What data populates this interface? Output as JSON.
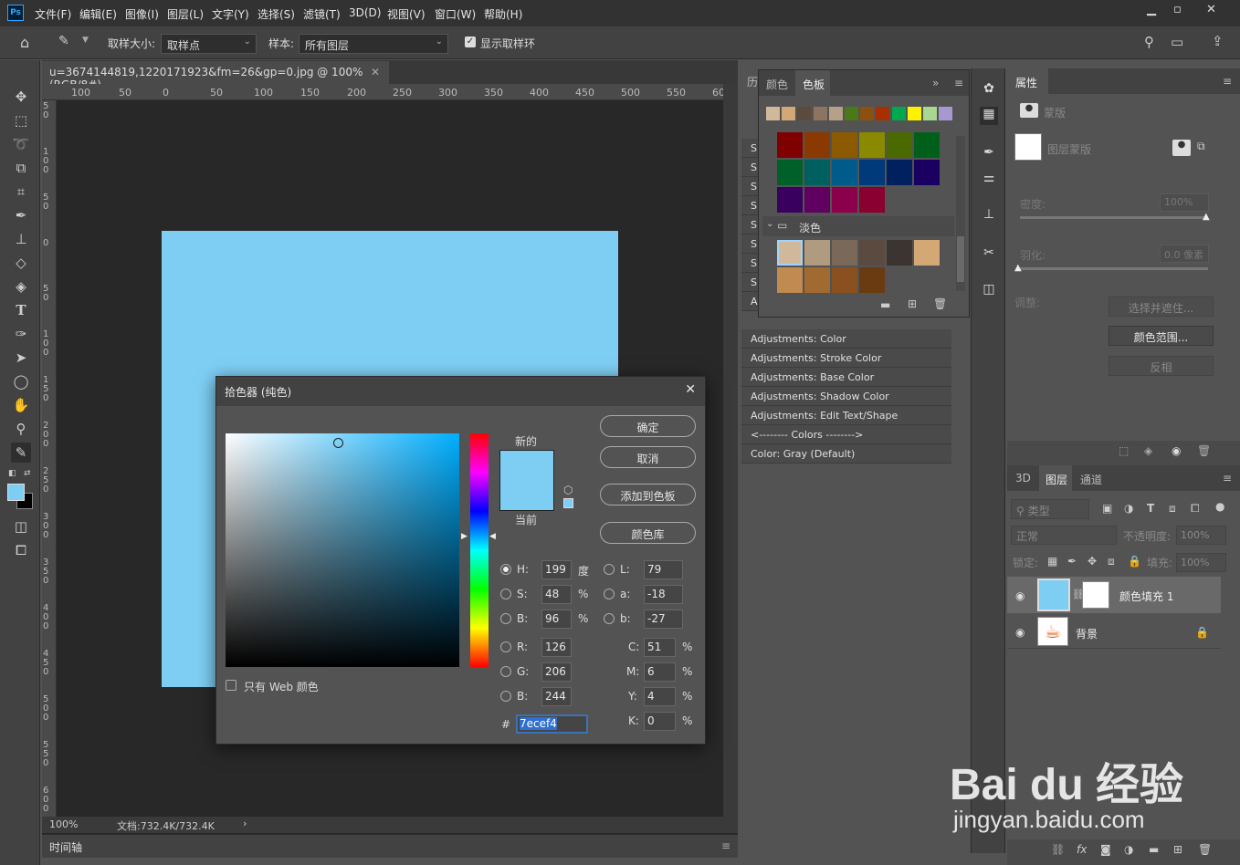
{
  "menu": [
    "文件(F)",
    "编辑(E)",
    "图像(I)",
    "图层(L)",
    "文字(Y)",
    "选择(S)",
    "滤镜(T)",
    "3D(D)",
    "视图(V)",
    "窗口(W)",
    "帮助(H)"
  ],
  "options": {
    "sample_size_label": "取样大小:",
    "sample_size_value": "取样点",
    "sample_label": "样本:",
    "sample_value": "所有图层",
    "show_ring_label": "显示取样环"
  },
  "document": {
    "tab_title": "u=3674144819,1220171923&fm=26&gp=0.jpg @ 100%(RGB/8#)",
    "zoom": "100%",
    "doc_size": "文档:732.4K/732.4K",
    "fill_color": "#7ecef4"
  },
  "hruler": [
    "100",
    "50",
    "0",
    "50",
    "100",
    "150",
    "200",
    "250",
    "300",
    "350",
    "400",
    "450",
    "500",
    "550",
    "60"
  ],
  "vruler": [
    "5\n0",
    "1\n0\n0",
    "5\n0",
    "0",
    "5\n0",
    "1\n0\n0",
    "1\n5\n0",
    "2\n0\n0",
    "2\n5\n0",
    "3\n0\n0",
    "3\n5\n0",
    "4\n0\n0",
    "4\n5\n0",
    "5\n0\n0",
    "5\n5\n0",
    "6\n0\n0"
  ],
  "timeline_label": "时间轴",
  "actions": {
    "collapsed_prefixes": [
      "S",
      "S",
      "S",
      "S",
      "S",
      "S",
      "S",
      "S",
      "A"
    ],
    "items": [
      "Adjustments: Color",
      "Adjustments: Stroke Color",
      "Adjustments: Base Color",
      "Adjustments: Shadow Color",
      "Adjustments: Edit Text/Shape",
      "<-------- Colors -------->",
      "Color: Gray (Default)"
    ]
  },
  "swatches": {
    "tabs": [
      "颜色",
      "色板"
    ],
    "recent": [
      "#d2b89a",
      "#d4a874",
      "#5c4a3c",
      "#8c7460",
      "#b6a088",
      "#4a7a18",
      "#8c5010",
      "#a83000",
      "#00a850",
      "#fff200",
      "#a8d890",
      "#a898d0"
    ],
    "deep": [
      "#800000",
      "#8a3a00",
      "#8c5a00",
      "#8a8a00",
      "#4a6a00",
      "#00601a",
      "#00602a",
      "#006060",
      "#005a8a",
      "#003a7a",
      "#002060",
      "#1a0060",
      "#3a0060",
      "#600060",
      "#8a004a",
      "#8a0030"
    ],
    "group_name": "淡色",
    "light": [
      "#d2b89a",
      "#b09a80",
      "#7a6858",
      "#5a4a40",
      "#3c3430",
      "#d4a874",
      "#c08a50",
      "#a06a30",
      "#8a5020",
      "#6a3a10"
    ]
  },
  "props": {
    "title": "属性",
    "mask_label": "蒙版",
    "layer_mask_label": "图层蒙版",
    "density_label": "密度:",
    "density_value": "100%",
    "feather_label": "羽化:",
    "feather_value": "0.0 像素",
    "adjust_label": "调整:",
    "btn_select": "选择并遮住...",
    "btn_range": "颜色范围...",
    "btn_invert": "反相"
  },
  "layers": {
    "tabs": [
      "3D",
      "图层",
      "通道"
    ],
    "filter_value": "类型",
    "blend_mode": "正常",
    "opacity_label": "不透明度:",
    "opacity_value": "100%",
    "lock_label": "锁定:",
    "fill_label": "填充:",
    "fill_value": "100%",
    "items": [
      {
        "name": "颜色填充 1"
      },
      {
        "name": "背景"
      }
    ]
  },
  "dialog": {
    "title": "拾色器 (纯色)",
    "new_label": "新的",
    "current_label": "当前",
    "ok": "确定",
    "cancel": "取消",
    "add_swatch": "添加到色板",
    "color_lib": "颜色库",
    "web_only": "只有 Web 颜色",
    "H": "199",
    "S": "48",
    "B": "96",
    "L": "79",
    "a": "-18",
    "b": "-27",
    "R": "126",
    "G": "206",
    "Bv": "244",
    "C": "51",
    "M": "6",
    "Y": "4",
    "K": "0",
    "hex": "7ecef4",
    "unit_deg": "度",
    "unit_pct": "%",
    "hash": "#"
  },
  "watermark": {
    "brand": "Bai du 经验",
    "url": "jingyan.baidu.com"
  }
}
